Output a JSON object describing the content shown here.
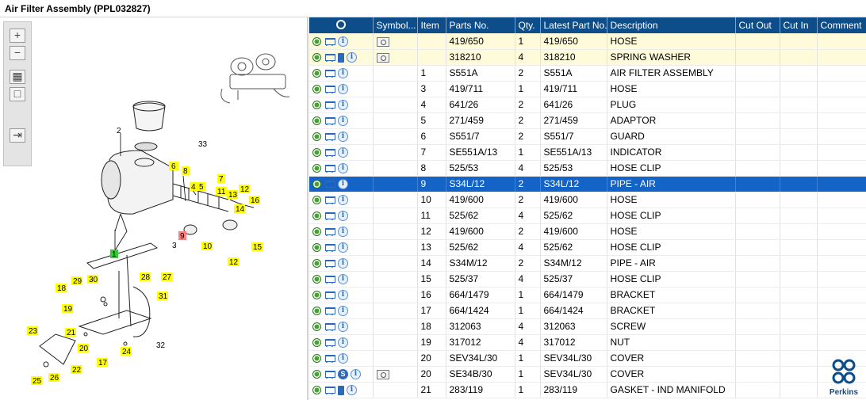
{
  "window": {
    "title": "Air Filter Assembly (PPL032827)"
  },
  "colors": {
    "header_bg": "#0c4d8a",
    "selected_row": "#1464c8",
    "highlight_row": "#fdfbd9",
    "callout_yellow": "#ffff00",
    "callout_green": "#33cc33",
    "callout_red": "#ff8080"
  },
  "toolbar": {
    "icons": [
      "zoom-in-icon",
      "zoom-out-icon",
      "fit-view-icon",
      "actual-size-icon",
      "export-icon"
    ]
  },
  "grid": {
    "headers": {
      "search": "",
      "symbol": "Symbol...",
      "item": "Item",
      "parts_no": "Parts No.",
      "qty": "Qty.",
      "latest_part_no": "Latest Part No.",
      "description": "Description",
      "cut_out": "Cut Out",
      "cut_in": "Cut In",
      "comment": "Comment"
    },
    "rows": [
      {
        "item": "",
        "parts_no": "419/650",
        "qty": "1",
        "latest": "419/650",
        "desc": "HOSE",
        "book": false,
        "s": false,
        "sym": true,
        "style": "hl"
      },
      {
        "item": "",
        "parts_no": "318210",
        "qty": "4",
        "latest": "318210",
        "desc": "SPRING WASHER",
        "book": true,
        "s": false,
        "sym": true,
        "style": "hl"
      },
      {
        "item": "1",
        "parts_no": "S551A",
        "qty": "2",
        "latest": "S551A",
        "desc": "AIR FILTER ASSEMBLY",
        "book": false,
        "s": false,
        "sym": false,
        "style": ""
      },
      {
        "item": "3",
        "parts_no": "419/711",
        "qty": "1",
        "latest": "419/711",
        "desc": "HOSE",
        "book": false,
        "s": false,
        "sym": false,
        "style": ""
      },
      {
        "item": "4",
        "parts_no": "641/26",
        "qty": "2",
        "latest": "641/26",
        "desc": "PLUG",
        "book": false,
        "s": false,
        "sym": false,
        "style": ""
      },
      {
        "item": "5",
        "parts_no": "271/459",
        "qty": "2",
        "latest": "271/459",
        "desc": "ADAPTOR",
        "book": false,
        "s": false,
        "sym": false,
        "style": ""
      },
      {
        "item": "6",
        "parts_no": "S551/7",
        "qty": "2",
        "latest": "S551/7",
        "desc": "GUARD",
        "book": false,
        "s": false,
        "sym": false,
        "style": ""
      },
      {
        "item": "7",
        "parts_no": "SE551A/13",
        "qty": "1",
        "latest": "SE551A/13",
        "desc": "INDICATOR",
        "book": false,
        "s": false,
        "sym": false,
        "style": ""
      },
      {
        "item": "8",
        "parts_no": "525/53",
        "qty": "4",
        "latest": "525/53",
        "desc": "HOSE CLIP",
        "book": false,
        "s": false,
        "sym": false,
        "style": ""
      },
      {
        "item": "9",
        "parts_no": "S34L/12",
        "qty": "2",
        "latest": "S34L/12",
        "desc": "PIPE - AIR",
        "book": false,
        "s": false,
        "sym": false,
        "style": "sel"
      },
      {
        "item": "10",
        "parts_no": "419/600",
        "qty": "2",
        "latest": "419/600",
        "desc": "HOSE",
        "book": false,
        "s": false,
        "sym": false,
        "style": ""
      },
      {
        "item": "11",
        "parts_no": "525/62",
        "qty": "4",
        "latest": "525/62",
        "desc": "HOSE CLIP",
        "book": false,
        "s": false,
        "sym": false,
        "style": ""
      },
      {
        "item": "12",
        "parts_no": "419/600",
        "qty": "2",
        "latest": "419/600",
        "desc": "HOSE",
        "book": false,
        "s": false,
        "sym": false,
        "style": ""
      },
      {
        "item": "13",
        "parts_no": "525/62",
        "qty": "4",
        "latest": "525/62",
        "desc": "HOSE CLIP",
        "book": false,
        "s": false,
        "sym": false,
        "style": ""
      },
      {
        "item": "14",
        "parts_no": "S34M/12",
        "qty": "2",
        "latest": "S34M/12",
        "desc": "PIPE - AIR",
        "book": false,
        "s": false,
        "sym": false,
        "style": ""
      },
      {
        "item": "15",
        "parts_no": "525/37",
        "qty": "4",
        "latest": "525/37",
        "desc": "HOSE CLIP",
        "book": false,
        "s": false,
        "sym": false,
        "style": ""
      },
      {
        "item": "16",
        "parts_no": "664/1479",
        "qty": "1",
        "latest": "664/1479",
        "desc": "BRACKET",
        "book": false,
        "s": false,
        "sym": false,
        "style": ""
      },
      {
        "item": "17",
        "parts_no": "664/1424",
        "qty": "1",
        "latest": "664/1424",
        "desc": "BRACKET",
        "book": false,
        "s": false,
        "sym": false,
        "style": ""
      },
      {
        "item": "18",
        "parts_no": "312063",
        "qty": "4",
        "latest": "312063",
        "desc": "SCREW",
        "book": false,
        "s": false,
        "sym": false,
        "style": ""
      },
      {
        "item": "19",
        "parts_no": "317012",
        "qty": "4",
        "latest": "317012",
        "desc": "NUT",
        "book": false,
        "s": false,
        "sym": false,
        "style": ""
      },
      {
        "item": "20",
        "parts_no": "SEV34L/30",
        "qty": "1",
        "latest": "SEV34L/30",
        "desc": "COVER",
        "book": false,
        "s": false,
        "sym": false,
        "style": ""
      },
      {
        "item": "20",
        "parts_no": "SE34B/30",
        "qty": "1",
        "latest": "SEV34L/30",
        "desc": "COVER",
        "book": false,
        "s": true,
        "sym": true,
        "style": ""
      },
      {
        "item": "21",
        "parts_no": "283/119",
        "qty": "1",
        "latest": "283/119",
        "desc": "GASKET - IND MANIFOLD",
        "book": true,
        "s": false,
        "sym": false,
        "style": ""
      }
    ]
  },
  "diagram": {
    "callouts": [
      "1",
      "2",
      "3",
      "4",
      "5",
      "6",
      "7",
      "8",
      "9",
      "10",
      "11",
      "12",
      "12",
      "13",
      "14",
      "15",
      "16",
      "17",
      "18",
      "19",
      "20",
      "21",
      "22",
      "23",
      "24",
      "25",
      "26",
      "27",
      "28",
      "29",
      "30",
      "31",
      "32",
      "33"
    ]
  },
  "logo": {
    "text": "Perkins"
  }
}
